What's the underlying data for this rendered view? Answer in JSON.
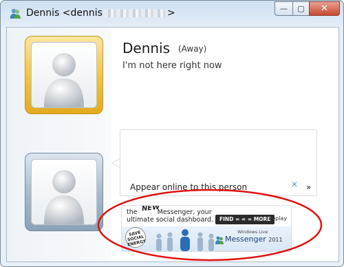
{
  "window": {
    "title_name": "Dennis <dennis",
    "title_end": ">",
    "minimize_glyph": "—",
    "maximize_glyph": "▢",
    "close_glyph": "✕"
  },
  "contact": {
    "name": "Dennis",
    "status": "(Away)",
    "personal_message": "I'm not here right now"
  },
  "conversation": {
    "action_link": "Appear online to this person",
    "chevron": "»"
  },
  "ad": {
    "headline_pre": "the",
    "headline_new": "NEW",
    "headline_line1": "Messenger, your",
    "headline_line2": "ultimate social dashboard.",
    "find_button": "FIND = = = MORE",
    "replay": "Replay",
    "close": "✕",
    "badge_line1": "SAVE",
    "badge_line2": "SOCIAL",
    "badge_line3": "ENERGY",
    "brand_small": "Windows Live",
    "brand": "Messenger",
    "brand_year": "2011"
  },
  "colors": {
    "away_frame": "#f0c648",
    "self_frame": "#a9bccd",
    "annotation": "#e01010",
    "titlebar": "#dfeaf6"
  },
  "icons": [
    "messenger-buddy-icon",
    "minimize-icon",
    "maximize-icon",
    "close-icon",
    "chevron-right-icon",
    "ad-close-icon",
    "avatar-placeholder-icon"
  ]
}
